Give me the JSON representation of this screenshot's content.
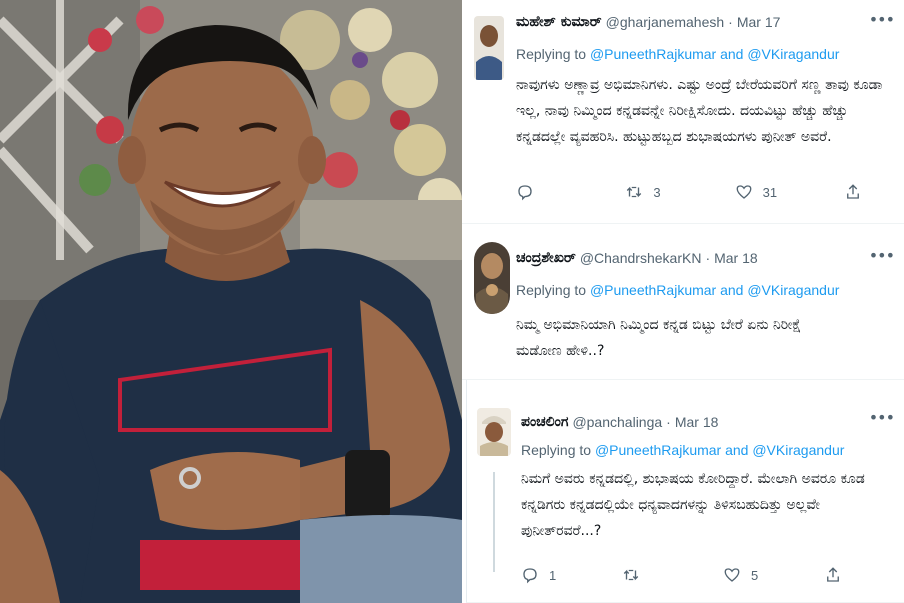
{
  "tweets": [
    {
      "name": "ಮಹೇಶ್ ಕುಮಾರ್",
      "handle": "@gharjanemahesh",
      "date": "Mar 17",
      "replying_prefix": "Replying to",
      "replying_mentions": "@PuneethRajkumar and @VKiragandur",
      "text": "ನಾವುಗಳು ಅಣ್ಣಾವ್ರ ಅಭಿಮಾನಿಗಳು. ಎಷ್ಟು ಅಂದ್ರೆ ಬೇರೆಯವರಿಗೆ ಸಣ್ಣ ತಾವು ಕೂಡಾ ಇಲ್ಲ, ನಾವು ನಿಮ್ಮಿಂದ ಕನ್ನಡವನ್ನೇ ನಿರೀಕ್ಷಿಸೋದು. ದಯವಿಟ್ಟು ಹೆಚ್ಚು ಹೆಚ್ಚು ಕನ್ನಡದಲ್ಲೇ ವ್ಯವಹರಿಸಿ. ಹುಟ್ಟುಹಬ್ಬದ ಶುಭಾಷಯಗಳು ಪುನೀತ್ ಅವರೆ.",
      "retweets": "3",
      "likes": "31"
    },
    {
      "name": "ಚಂದ್ರಶೇಖರ್",
      "handle": "@ChandrshekarKN",
      "date": "Mar 18",
      "replying_prefix": "Replying to",
      "replying_mentions": "@PuneethRajkumar and @VKiragandur",
      "text": "ನಿಮ್ಮ ಅಭಿಮಾನಿಯಾಗಿ ನಿಮ್ಮಿಂದ ಕನ್ನಡ ಬಿಟ್ಟು ಬೇರೆ ಏನು ನಿರೀಕ್ಷೆ ಮಡೋಣ ಹೇಳಿ..?",
      "retweets": "",
      "likes": ""
    },
    {
      "name": "ಪಂಚಲಿಂಗ",
      "handle": "@panchalinga",
      "date": "Mar 18",
      "replying_prefix": "Replying to",
      "replying_mentions": "@PuneethRajkumar and @VKiragandur",
      "text": "ನಿಮಗೆ ಅವರು ಕನ್ನಡದಲ್ಲಿ, ಶುಭಾಷಯ ಕೋರಿದ್ದಾರೆ. ಮೇಲಾಗಿ ಅವರೂ ಕೂಡ ಕನ್ನಡಿಗರು ಕನ್ನಡದಲ್ಲಿಯೇ ಧನ್ಯವಾದಗಳನ್ನು ತಿಳಿಸಬಹುದಿತ್ತು ಅಲ್ಲವೇ ಪುನೀತ್‌ರವರೆ...?",
      "replies": "1",
      "likes": "5"
    }
  ],
  "icons": {
    "reply": "reply-icon",
    "retweet": "retweet-icon",
    "like": "heart-icon",
    "share": "share-icon",
    "more": "more-icon"
  },
  "colors": {
    "link": "#1d9bf0",
    "secondary_text": "#536471",
    "primary_text": "#0f1419",
    "shirt": "#1f2f45",
    "shirt_accent": "#c2203a"
  }
}
